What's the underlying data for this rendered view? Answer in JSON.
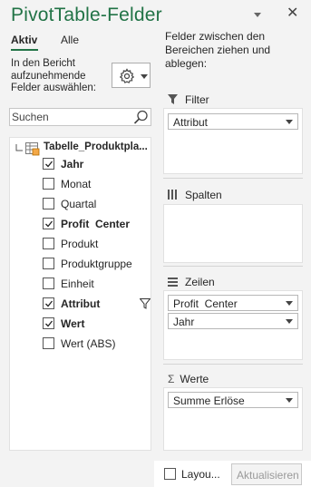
{
  "pane": {
    "title": "PivotTable-Felder",
    "accent_color": "#217346",
    "title_dropdown_icon": "chevron-down-icon",
    "close_icon": "close-icon"
  },
  "tabs": [
    {
      "label": "Aktiv",
      "active": true
    },
    {
      "label": "Alle",
      "active": false
    }
  ],
  "field_chooser": {
    "label": "In den Bericht aufzunehmende Felder auswählen:",
    "tools_icon": "gear-icon"
  },
  "search": {
    "placeholder": "Suchen",
    "icon": "search-icon"
  },
  "field_list": {
    "table_name": "Tabelle_Produktpla...",
    "fields": [
      {
        "label": "Jahr",
        "checked": true,
        "bold": true
      },
      {
        "label": "Monat",
        "checked": false,
        "bold": false
      },
      {
        "label": "Quartal",
        "checked": false,
        "bold": false
      },
      {
        "label": "Profit  Center",
        "checked": true,
        "bold": true
      },
      {
        "label": "Produkt",
        "checked": false,
        "bold": false
      },
      {
        "label": "Produktgruppe",
        "checked": false,
        "bold": false
      },
      {
        "label": "Einheit",
        "checked": false,
        "bold": false
      },
      {
        "label": "Attribut",
        "checked": true,
        "bold": true,
        "filtered": true
      },
      {
        "label": "Wert",
        "checked": true,
        "bold": true
      },
      {
        "label": "Wert (ABS)",
        "checked": false,
        "bold": false
      }
    ]
  },
  "areas": {
    "instructions": "Felder zwischen den Bereichen ziehen und ablegen:",
    "filter": {
      "label": "Filter",
      "icon": "filter-icon",
      "items": [
        "Attribut"
      ]
    },
    "columns": {
      "label": "Spalten",
      "icon": "columns-icon",
      "items": []
    },
    "rows": {
      "label": "Zeilen",
      "icon": "rows-icon",
      "items": [
        "Profit  Center",
        "Jahr"
      ]
    },
    "values": {
      "label": "Werte",
      "icon": "sigma-icon",
      "items": [
        "Summe Erlöse"
      ]
    }
  },
  "footer": {
    "defer_label": "Layou...",
    "defer_checked": false,
    "update_label": "Aktualisieren",
    "update_enabled": false
  }
}
